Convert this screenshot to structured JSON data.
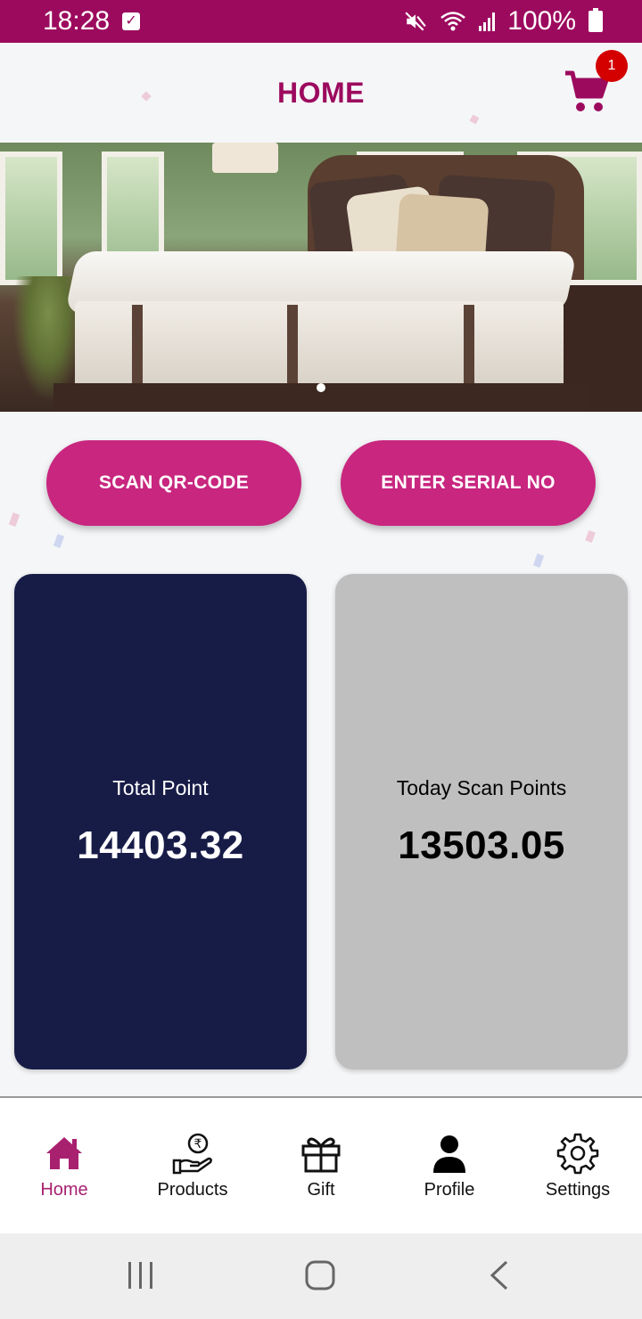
{
  "status_bar": {
    "time": "18:28",
    "battery": "100%"
  },
  "header": {
    "title": "HOME",
    "cart_count": "1"
  },
  "banner": {
    "image_subject": "mattress-bedroom",
    "active_slide": 1,
    "slide_count": 1
  },
  "actions": {
    "scan_label": "SCAN QR-CODE",
    "serial_label": "ENTER SERIAL NO"
  },
  "cards": {
    "total": {
      "label": "Total Point",
      "value": "14403.32"
    },
    "today": {
      "label": "Today Scan Points",
      "value": "13503.05"
    }
  },
  "bottom_nav": {
    "items": [
      {
        "label": "Home",
        "icon": "home-icon",
        "active": true
      },
      {
        "label": "Products",
        "icon": "rupee-hand-icon",
        "active": false
      },
      {
        "label": "Gift",
        "icon": "gift-icon",
        "active": false
      },
      {
        "label": "Profile",
        "icon": "person-icon",
        "active": false
      },
      {
        "label": "Settings",
        "icon": "gear-icon",
        "active": false
      }
    ]
  },
  "colors": {
    "brand": "#9c0a5e",
    "button": "#c8267f",
    "card_total": "#171c47",
    "card_today": "#bfbfbf",
    "badge": "#d40000"
  }
}
